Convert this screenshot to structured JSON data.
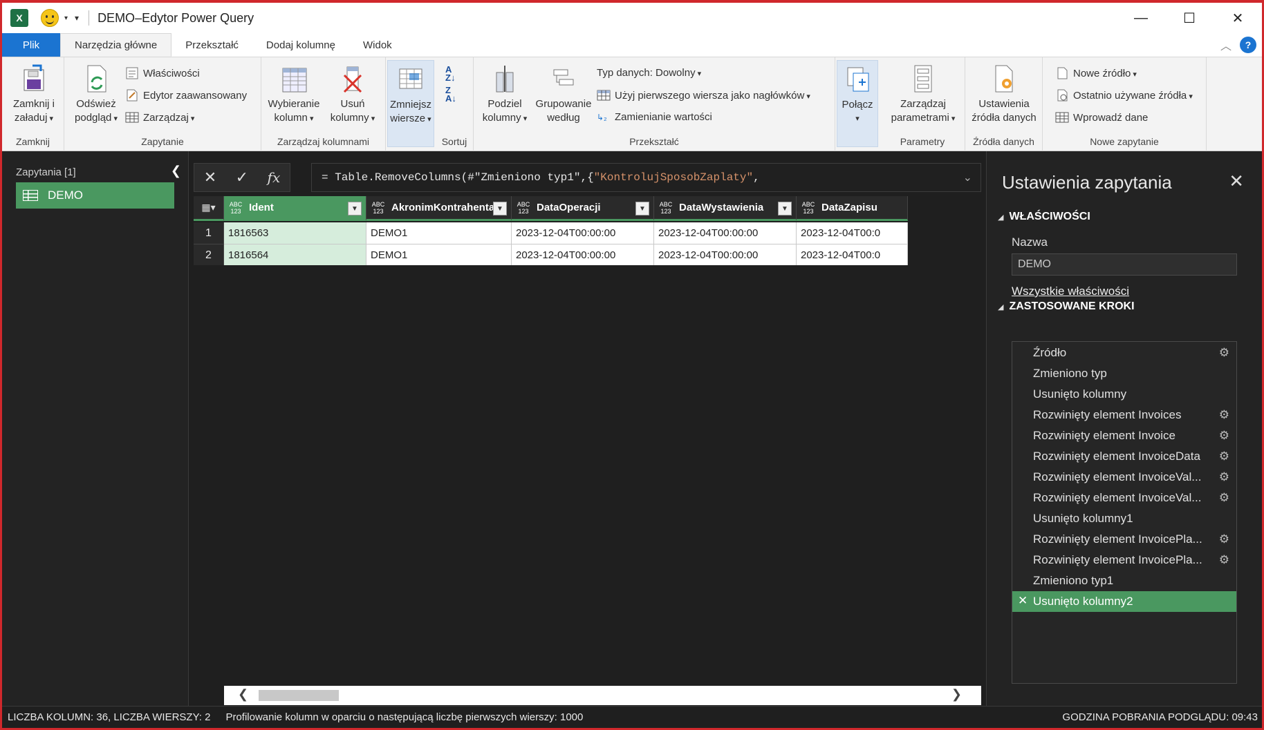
{
  "titlebar": {
    "title": "DEMO–Edytor Power Query",
    "app_icon": "X",
    "minimize": "—",
    "maximize": "☐",
    "close": "✕"
  },
  "tabs": [
    {
      "label": "Plik"
    },
    {
      "label": "Narzędzia główne"
    },
    {
      "label": "Przekształć"
    },
    {
      "label": "Dodaj kolumnę"
    },
    {
      "label": "Widok"
    }
  ],
  "ribbon": {
    "close_load": "Zamknij i\nzaładuj",
    "group_close": "Zamknij",
    "refresh": "Odśwież\npodgląd",
    "properties": "Właściwości",
    "advanced_editor": "Edytor zaawansowany",
    "manage": "Zarządzaj",
    "group_query": "Zapytanie",
    "choose_columns": "Wybieranie\nkolumn",
    "remove_columns": "Usuń\nkolumny",
    "group_manage_columns": "Zarządzaj kolumnami",
    "reduce_rows": "Zmniejsz\nwiersze",
    "group_sort": "Sortuj",
    "split_column": "Podziel\nkolumny",
    "group_by": "Grupowanie\nwedług",
    "data_type": "Typ danych: Dowolny",
    "use_first_row": "Użyj pierwszego wiersza jako nagłówków",
    "replace_values": "Zamienianie wartości",
    "group_transform": "Przekształć",
    "combine": "Połącz",
    "manage_params": "Zarządzaj\nparametrami",
    "group_params": "Parametry",
    "source_settings": "Ustawienia\nźródła danych",
    "group_sources": "Źródła danych",
    "new_source": "Nowe źródło",
    "recent_sources": "Ostatnio używane źródła",
    "enter_data": "Wprowadź dane",
    "group_new_query": "Nowe zapytanie"
  },
  "queries": {
    "title": "Zapytania [1]",
    "items": [
      {
        "label": "DEMO"
      }
    ]
  },
  "formula": {
    "prefix": "= Table.RemoveColumns(#\"Zmieniono typ1\",{",
    "string": "\"KontrolujSposobZaplaty\"",
    "suffix": ","
  },
  "grid": {
    "type_label": "ABC\n123",
    "columns": [
      "Ident",
      "AkronimKontrahenta",
      "DataOperacji",
      "DataWystawienia",
      "DataZapisu"
    ],
    "rows": [
      {
        "n": "1",
        "cells": [
          "1816563",
          "DEMO1",
          "2023-12-04T00:00:00",
          "2023-12-04T00:00:00",
          "2023-12-04T00:0"
        ]
      },
      {
        "n": "2",
        "cells": [
          "1816564",
          "DEMO1",
          "2023-12-04T00:00:00",
          "2023-12-04T00:00:00",
          "2023-12-04T00:0"
        ]
      }
    ]
  },
  "settings": {
    "title": "Ustawienia zapytania",
    "properties_head": "WŁAŚCIWOŚCI",
    "name_label": "Nazwa",
    "name_value": "DEMO",
    "all_properties": "Wszystkie właściwości",
    "steps_head": "ZASTOSOWANE KROKI",
    "steps": [
      {
        "label": "Źródło",
        "gear": true
      },
      {
        "label": "Zmieniono typ",
        "gear": false
      },
      {
        "label": "Usunięto kolumny",
        "gear": false
      },
      {
        "label": "Rozwinięty element Invoices",
        "gear": true
      },
      {
        "label": "Rozwinięty element Invoice",
        "gear": true
      },
      {
        "label": "Rozwinięty element InvoiceData",
        "gear": true
      },
      {
        "label": "Rozwinięty element InvoiceVal...",
        "gear": true
      },
      {
        "label": "Rozwinięty element InvoiceVal...",
        "gear": true
      },
      {
        "label": "Usunięto kolumny1",
        "gear": false
      },
      {
        "label": "Rozwinięty element InvoicePla...",
        "gear": true
      },
      {
        "label": "Rozwinięty element InvoicePla...",
        "gear": true
      },
      {
        "label": "Zmieniono typ1",
        "gear": false
      },
      {
        "label": "Usunięto kolumny2",
        "gear": false,
        "selected": true
      }
    ]
  },
  "status": {
    "counts": "LICZBA KOLUMN: 36, LICZBA WIERSZY: 2",
    "profiling": "Profilowanie kolumn w oparciu o następującą liczbę pierwszych wierszy: 1000",
    "preview_time": "GODZINA POBRANIA PODGLĄDU: 09:43"
  },
  "colors": {
    "accent_green": "#4a9860",
    "file_tab_blue": "#1b74d1",
    "frame_red": "#d0282c",
    "formula_string": "#d6926a"
  }
}
